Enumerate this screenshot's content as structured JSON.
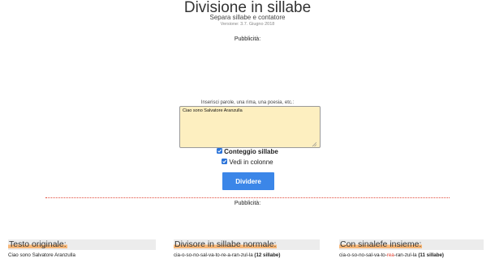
{
  "header": {
    "title": "Divisione in sillabe",
    "subtitle": "Separa sillabe e contatore",
    "version": "Versione: 3.7. Giugno 2018"
  },
  "ads": {
    "top_label": "Pubblicità:",
    "bottom_label": "Pubblicità:"
  },
  "form": {
    "input_label": "Inserisci parole, una rima, una poesia, etc.:",
    "input_value": "Ciao sono Salvatore Aranzulla",
    "options": [
      {
        "label": "Conteggio sillabe",
        "checked": true
      },
      {
        "label": "Vedi in colonne",
        "checked": true
      }
    ],
    "submit_label": "Dividere"
  },
  "results": {
    "original": {
      "heading": "Testo originale:",
      "text": "Ciao sono Salvatore Aranzulla"
    },
    "normal": {
      "heading": "Divisore in sillabe normale:",
      "syllables": "cia-o-so-no-sal-va-to-re-a-ran-zul-la",
      "count": "(12 sillabe)"
    },
    "sinalefe": {
      "heading": "Con sinalefe insieme:",
      "syllables_before": "cia-o-so-no-sal-va-to-",
      "syllables_highlight": "rea",
      "syllables_after": "-ran-zul-la",
      "count": "(11 sillabe)"
    }
  },
  "colors": {
    "input_bg": "#fdefc0",
    "button_bg": "#3b86e8",
    "checkbox": "#2a73d9",
    "divider": "#e14a3a",
    "heading_highlight": "#f7b778",
    "sinalefe_highlight": "#e03a2a"
  }
}
